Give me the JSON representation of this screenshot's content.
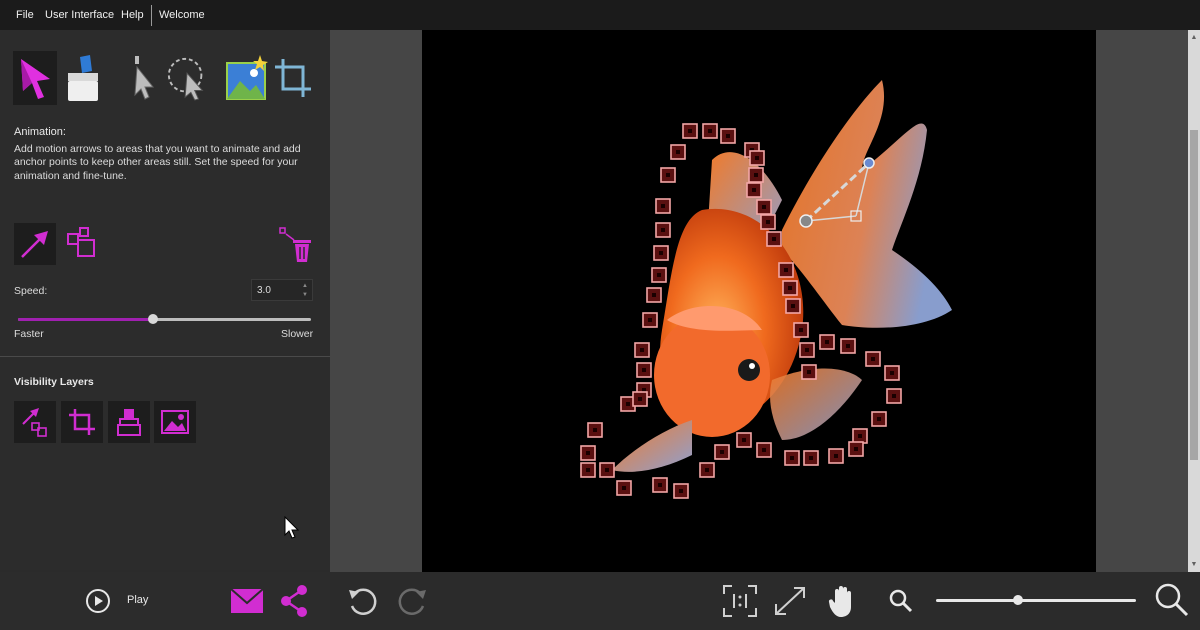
{
  "menu": {
    "file": "File",
    "user_interface": "User Interface",
    "help": "Help",
    "welcome": "Welcome"
  },
  "toolbar": {
    "tools": [
      {
        "name": "animate-arrow-tool",
        "active": true
      },
      {
        "name": "eraser-tool",
        "active": false
      },
      {
        "name": "pointer-tool",
        "active": false
      },
      {
        "name": "lasso-select-tool",
        "active": false
      },
      {
        "name": "image-tool",
        "active": false
      },
      {
        "name": "crop-tool",
        "active": false
      }
    ]
  },
  "animation": {
    "title": "Animation:",
    "description": "Add motion arrows to areas that you want to animate and add anchor points to keep other areas still. Set the speed for your animation and fine-tune."
  },
  "speed": {
    "label": "Speed:",
    "value": "3.0",
    "slider_level": 0.46,
    "faster_label": "Faster",
    "slower_label": "Slower"
  },
  "visibility": {
    "title": "Visibility Layers"
  },
  "bottom": {
    "play_label": "Play",
    "zoom_level": 0.41
  },
  "colors": {
    "accent": "#c020d0",
    "menubar": "#1b1b1b",
    "panel": "#2c2c2c",
    "canvas_bg": "#464646",
    "anchor": "#f2a6a6"
  },
  "icons": {
    "play": "play-icon",
    "mail": "mail-icon",
    "share": "share-icon",
    "undo": "undo-icon",
    "redo": "redo-icon",
    "actual_size": "actual-size-icon",
    "fit": "fit-to-screen-icon",
    "pan": "hand-pan-icon",
    "zoom_out": "zoom-out-icon",
    "zoom_in": "zoom-in-icon"
  }
}
